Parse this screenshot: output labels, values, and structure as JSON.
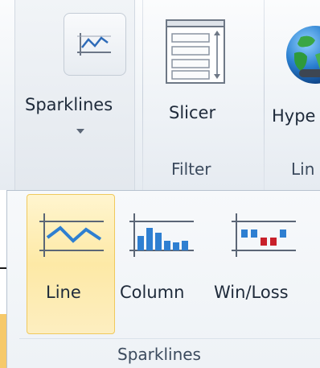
{
  "ribbon": {
    "sparklines_button": {
      "label": "Sparklines",
      "icon": "sparkline-icon"
    },
    "slicer_button": {
      "label": "Slicer",
      "icon": "slicer-icon"
    },
    "hyperlink_button": {
      "label": "Hype",
      "icon": "globe-icon"
    },
    "groups": {
      "filter": "Filter",
      "links": "Lin"
    }
  },
  "sparklines_menu": {
    "items": [
      {
        "label": "Line",
        "icon": "line-sparkline-icon",
        "state": "hover"
      },
      {
        "label": "Column",
        "icon": "column-sparkline-icon"
      },
      {
        "label": "Win/Loss",
        "icon": "win-loss-sparkline-icon"
      }
    ],
    "group_label": "Sparklines"
  },
  "colors": {
    "accent_blue": "#2e7fd1",
    "loss_red": "#c8202a",
    "hover_gold": "#fde9a6"
  }
}
